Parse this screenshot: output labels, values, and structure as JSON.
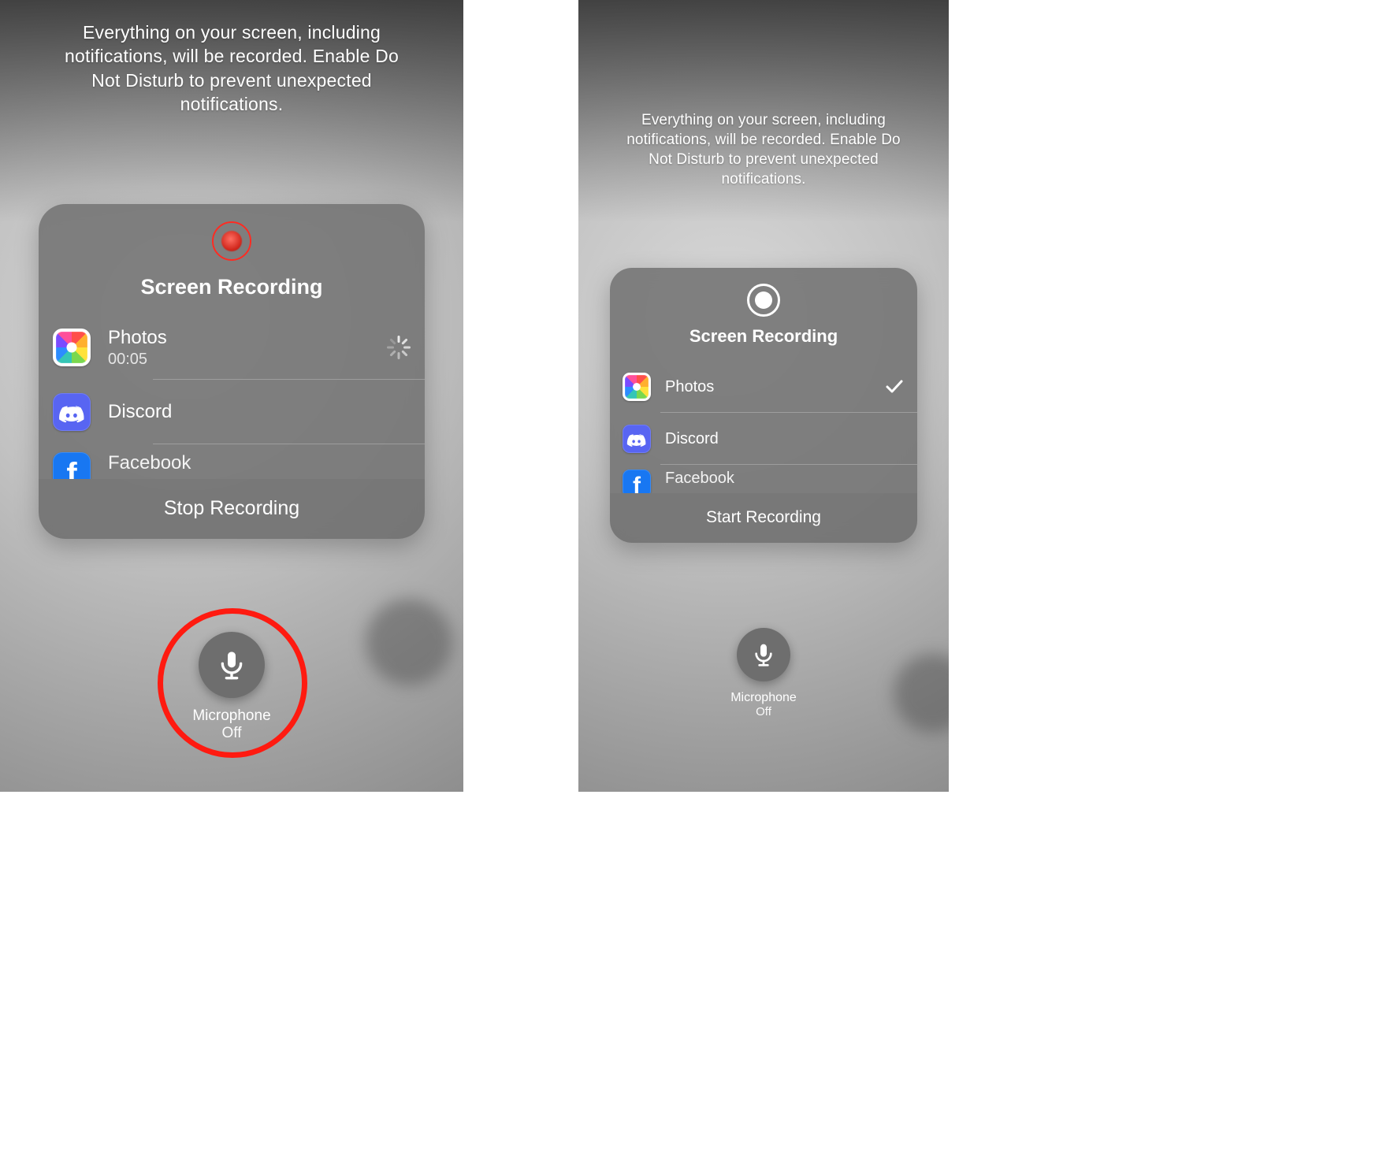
{
  "left": {
    "warning": "Everything on your screen, including notifications, will be recorded. Enable Do Not Disturb to prevent unexpected notifications.",
    "card": {
      "title": "Screen Recording",
      "apps": {
        "photos": {
          "label": "Photos",
          "subtitle": "00:05",
          "tail": "spinner"
        },
        "discord": {
          "label": "Discord"
        },
        "facebook": {
          "label": "Facebook"
        }
      },
      "footer": "Stop Recording"
    },
    "mic": {
      "label": "Microphone",
      "state": "Off"
    }
  },
  "right": {
    "warning": "Everything on your screen, including notifications, will be recorded. Enable Do Not Disturb to prevent unexpected notifications.",
    "card": {
      "title": "Screen Recording",
      "apps": {
        "photos": {
          "label": "Photos",
          "tail": "check"
        },
        "discord": {
          "label": "Discord"
        },
        "facebook": {
          "label": "Facebook"
        }
      },
      "footer": "Start Recording"
    },
    "mic": {
      "label": "Microphone",
      "state": "Off"
    }
  }
}
